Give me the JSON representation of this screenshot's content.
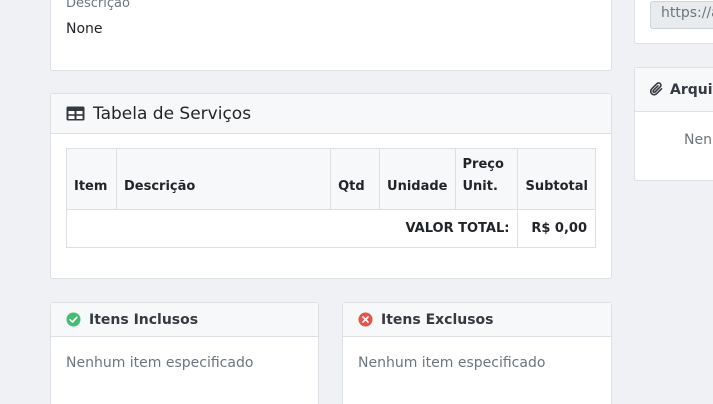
{
  "description_card": {
    "label": "Descrição",
    "value": "None"
  },
  "services_card": {
    "title": "Tabela de Serviços",
    "icon": "table-icon",
    "columns": [
      "Item",
      "Descrição",
      "Qtd",
      "Unidade",
      "Preço Unit.",
      "Subtotal"
    ],
    "total_label": "VALOR TOTAL:",
    "total_value": "R$ 0,00"
  },
  "included_card": {
    "title": "Itens Inclusos",
    "icon": "check-circle-icon",
    "empty_text": "Nenhum item especificado"
  },
  "excluded_card": {
    "title": "Itens Exclusos",
    "icon": "x-circle-icon",
    "empty_text": "Nenhum item especificado"
  },
  "link_card": {
    "value": "https://a"
  },
  "attachments_card": {
    "title": "Arquiv",
    "icon": "paperclip-icon",
    "empty_text": "Nenh"
  },
  "colors": {
    "success": "#3fbf6f",
    "danger": "#e5534b",
    "border": "#dcdfe4",
    "header_bg": "#f7f8fa",
    "page_bg": "#f0f1f4"
  }
}
